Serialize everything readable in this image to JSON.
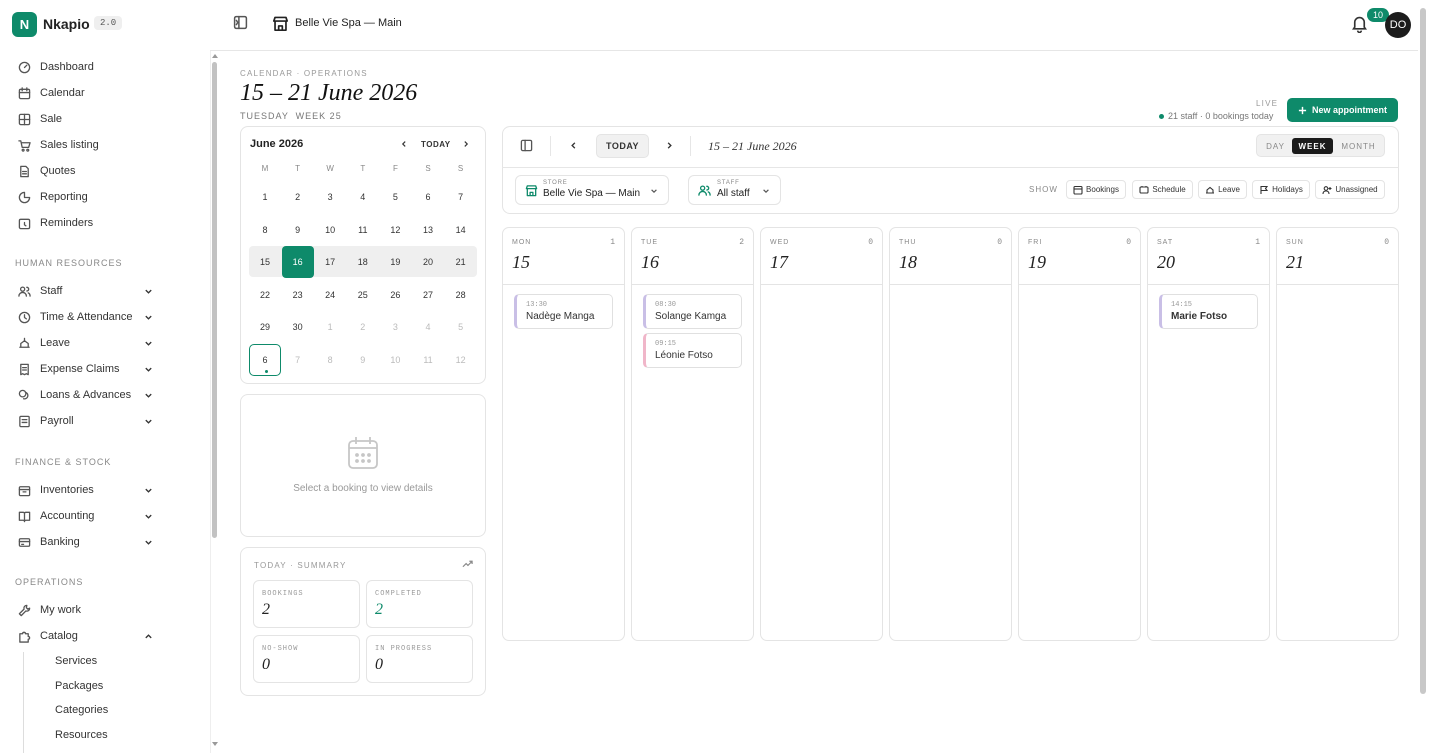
{
  "app": {
    "name": "Nkapio",
    "version": "2.0",
    "store": "Belle Vie Spa — Main",
    "notifications": "10",
    "avatar": "DO"
  },
  "sidebar": {
    "items": [
      {
        "label": "Dashboard",
        "icon": "dashboard-icon"
      },
      {
        "label": "Calendar",
        "icon": "calendar-icon"
      },
      {
        "label": "Sale",
        "icon": "sale-icon"
      },
      {
        "label": "Sales listing",
        "icon": "cart-icon"
      },
      {
        "label": "Quotes",
        "icon": "document-icon"
      },
      {
        "label": "Reporting",
        "icon": "chart-pie-icon"
      },
      {
        "label": "Reminders",
        "icon": "reminder-icon"
      }
    ],
    "hr_label": "HUMAN RESOURCES",
    "hr_items": [
      {
        "label": "Staff",
        "icon": "users-icon"
      },
      {
        "label": "Time & Attendance",
        "icon": "clock-icon"
      },
      {
        "label": "Leave",
        "icon": "leave-icon"
      },
      {
        "label": "Expense Claims",
        "icon": "receipt-icon"
      },
      {
        "label": "Loans & Advances",
        "icon": "coins-icon"
      },
      {
        "label": "Payroll",
        "icon": "payroll-icon"
      }
    ],
    "fin_label": "FINANCE & STOCK",
    "fin_items": [
      {
        "label": "Inventories",
        "icon": "box-icon"
      },
      {
        "label": "Accounting",
        "icon": "book-icon"
      },
      {
        "label": "Banking",
        "icon": "bank-icon"
      }
    ],
    "ops_label": "OPERATIONS",
    "ops_items": [
      {
        "label": "My work",
        "icon": "wrench-icon"
      },
      {
        "label": "Catalog",
        "icon": "puzzle-icon"
      }
    ],
    "catalog_sub": [
      "Services",
      "Packages",
      "Categories",
      "Resources"
    ]
  },
  "header": {
    "caption": "CALENDAR · OPERATIONS",
    "title": "15 – 21 June 2026",
    "subtitle": "TUESDAY  WEEK 25",
    "live": "LIVE",
    "live_sub": "21 staff · 0 bookings today",
    "new_button": "New appointment"
  },
  "mini_cal": {
    "title": "June 2026",
    "today": "TODAY",
    "dow": [
      "M",
      "T",
      "W",
      "T",
      "F",
      "S",
      "S"
    ],
    "rows": [
      [
        "1",
        "2",
        "3",
        "4",
        "5",
        "6",
        "7"
      ],
      [
        "8",
        "9",
        "10",
        "11",
        "12",
        "13",
        "14"
      ],
      [
        "15",
        "16",
        "17",
        "18",
        "19",
        "20",
        "21"
      ],
      [
        "22",
        "23",
        "24",
        "25",
        "26",
        "27",
        "28"
      ],
      [
        "29",
        "30",
        "1",
        "2",
        "3",
        "4",
        "5"
      ],
      [
        "6",
        "7",
        "8",
        "9",
        "10",
        "11",
        "12"
      ]
    ]
  },
  "details": {
    "empty": "Select a booking to view details"
  },
  "summary": {
    "caption": "TODAY · SUMMARY",
    "stats": [
      {
        "label": "BOOKINGS",
        "value": "2"
      },
      {
        "label": "COMPLETED",
        "value": "2"
      },
      {
        "label": "NO-SHOW",
        "value": "0"
      },
      {
        "label": "IN PROGRESS",
        "value": "0"
      }
    ]
  },
  "toolbar": {
    "today": "TODAY",
    "range": "15 – 21 June 2026",
    "views": [
      "DAY",
      "WEEK",
      "MONTH"
    ],
    "active_view": "WEEK",
    "store_label": "STORE",
    "store_value": "Belle Vie Spa — Main",
    "staff_label": "STAFF",
    "staff_value": "All staff",
    "show_label": "SHOW",
    "chips": [
      "Bookings",
      "Schedule",
      "Leave",
      "Holidays",
      "Unassigned"
    ]
  },
  "week": [
    {
      "dow": "MON",
      "date": "15",
      "count": "1",
      "appts": [
        {
          "time": "13:30",
          "name": "Nadège Manga",
          "style": "purple"
        }
      ]
    },
    {
      "dow": "TUE",
      "date": "16",
      "count": "2",
      "appts": [
        {
          "time": "08:30",
          "name": "Solange Kamga",
          "style": "purple"
        },
        {
          "time": "09:15",
          "name": "Léonie Fotso",
          "style": "pink"
        }
      ]
    },
    {
      "dow": "WED",
      "date": "17",
      "count": "0",
      "appts": []
    },
    {
      "dow": "THU",
      "date": "18",
      "count": "0",
      "appts": []
    },
    {
      "dow": "FRI",
      "date": "19",
      "count": "0",
      "appts": []
    },
    {
      "dow": "SAT",
      "date": "20",
      "count": "1",
      "appts": [
        {
          "time": "14:15",
          "name": "Marie Fotso",
          "style": "purple-bold"
        }
      ]
    },
    {
      "dow": "SUN",
      "date": "21",
      "count": "0",
      "appts": []
    }
  ],
  "colors": {
    "accent": "#0e8a6a",
    "dark": "#1b1b1b"
  }
}
